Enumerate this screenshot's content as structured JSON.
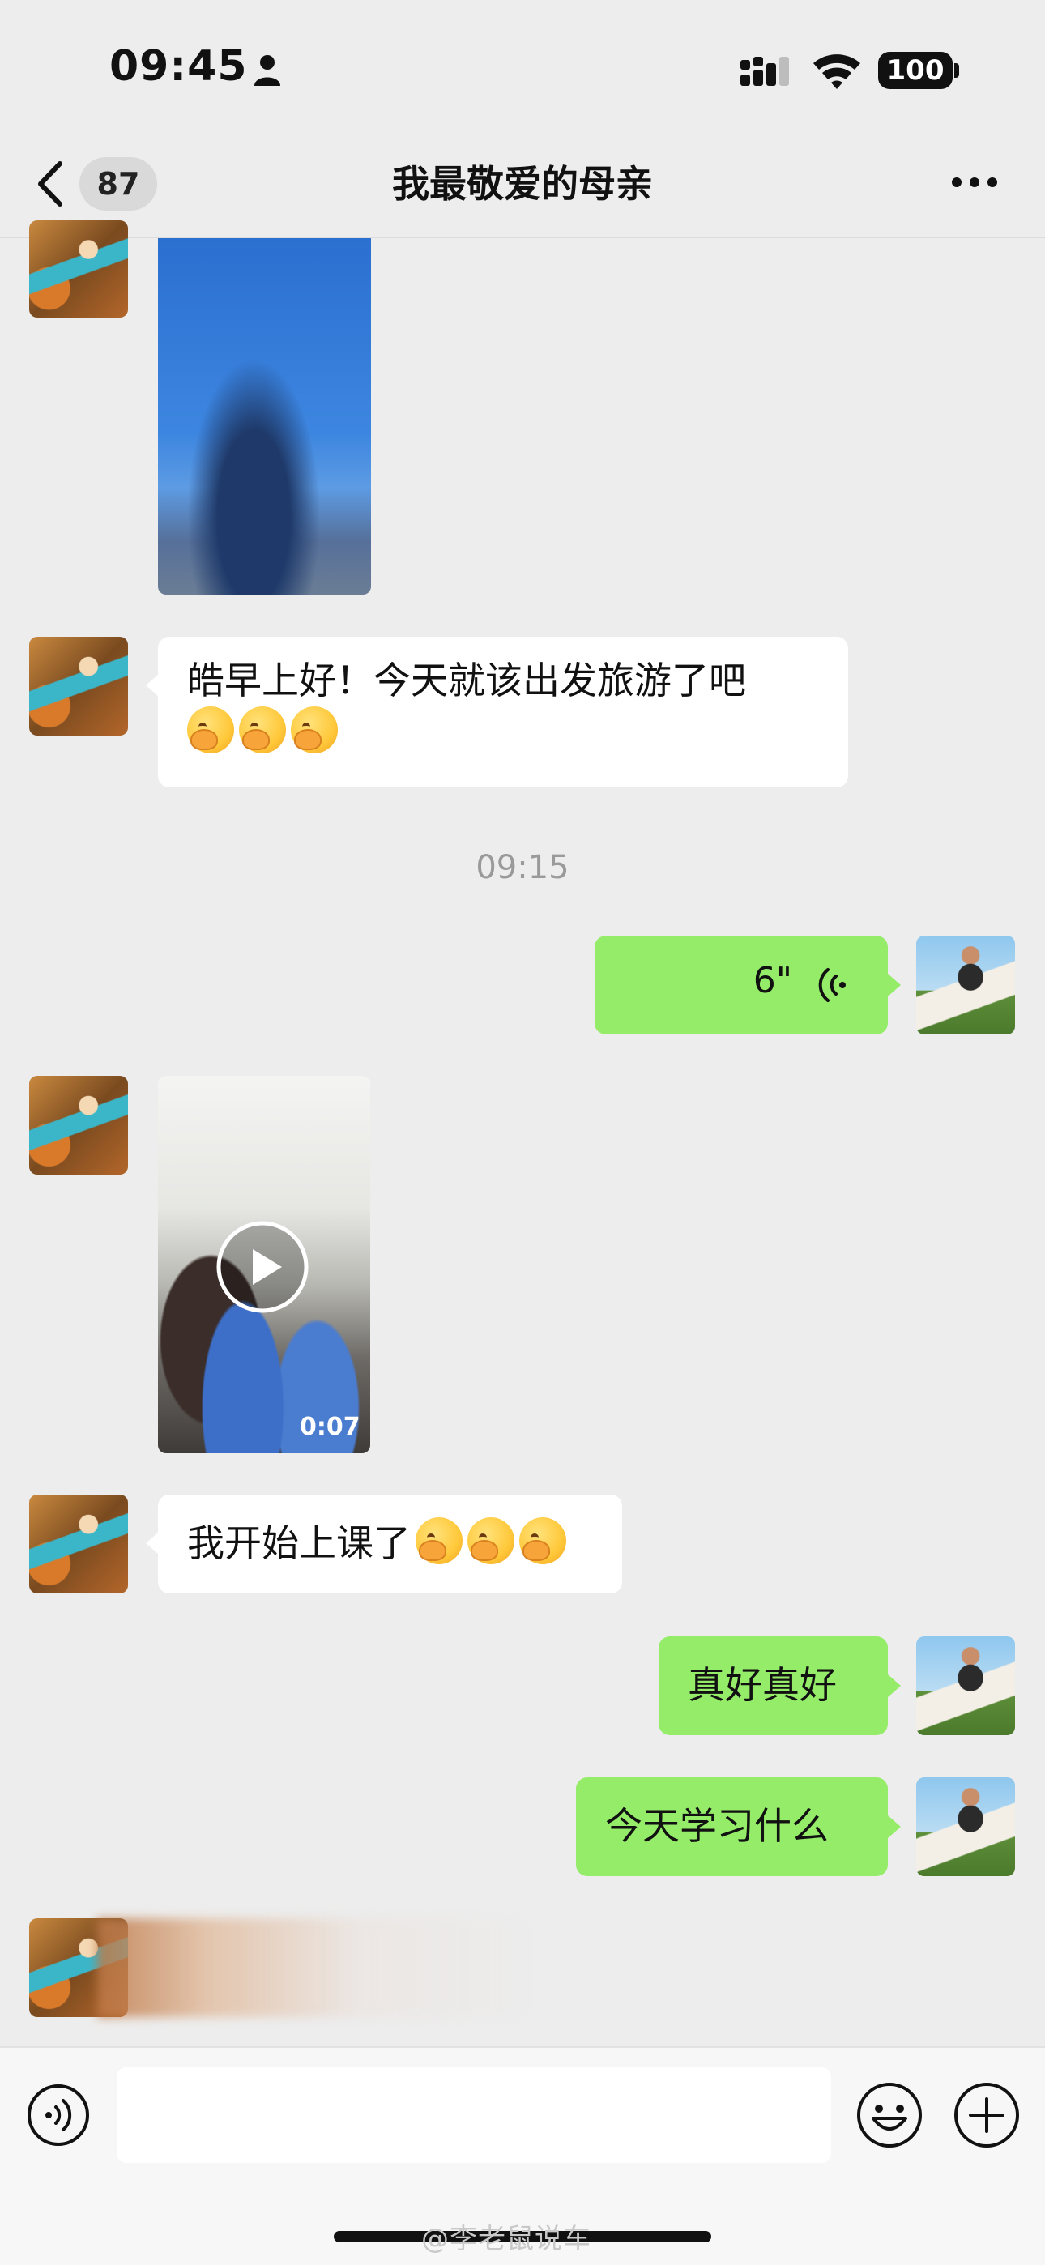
{
  "status_bar": {
    "time": "09:45",
    "battery": "100"
  },
  "nav": {
    "unread_count": "87",
    "title": "我最敬爱的母亲"
  },
  "messages": [
    {
      "type": "image",
      "from": "mom"
    },
    {
      "type": "text",
      "from": "mom",
      "text": "皓早上好！今天就该出发旅游了吧",
      "emoji": [
        "hot-face-emoji",
        "hot-face-emoji",
        "hot-face-emoji"
      ]
    },
    {
      "type": "timestamp",
      "text": "09:15"
    },
    {
      "type": "voice",
      "from": "me",
      "text": "6\""
    },
    {
      "type": "video",
      "from": "mom",
      "duration": "0:07"
    },
    {
      "type": "text",
      "from": "mom",
      "text": "我开始上课了",
      "emoji": [
        "thinking-face-emoji",
        "thinking-face-emoji",
        "thinking-face-emoji"
      ]
    },
    {
      "type": "text",
      "from": "me",
      "text": "真好真好"
    },
    {
      "type": "text",
      "from": "me",
      "text": "今天学习什么"
    },
    {
      "type": "blurred",
      "from": "mom"
    }
  ],
  "input": {
    "placeholder": ""
  },
  "watermark": "@李老鼠说车",
  "colors": {
    "background": "#ededed",
    "bubble_mine": "#95ec69",
    "bubble_theirs": "#ffffff"
  }
}
